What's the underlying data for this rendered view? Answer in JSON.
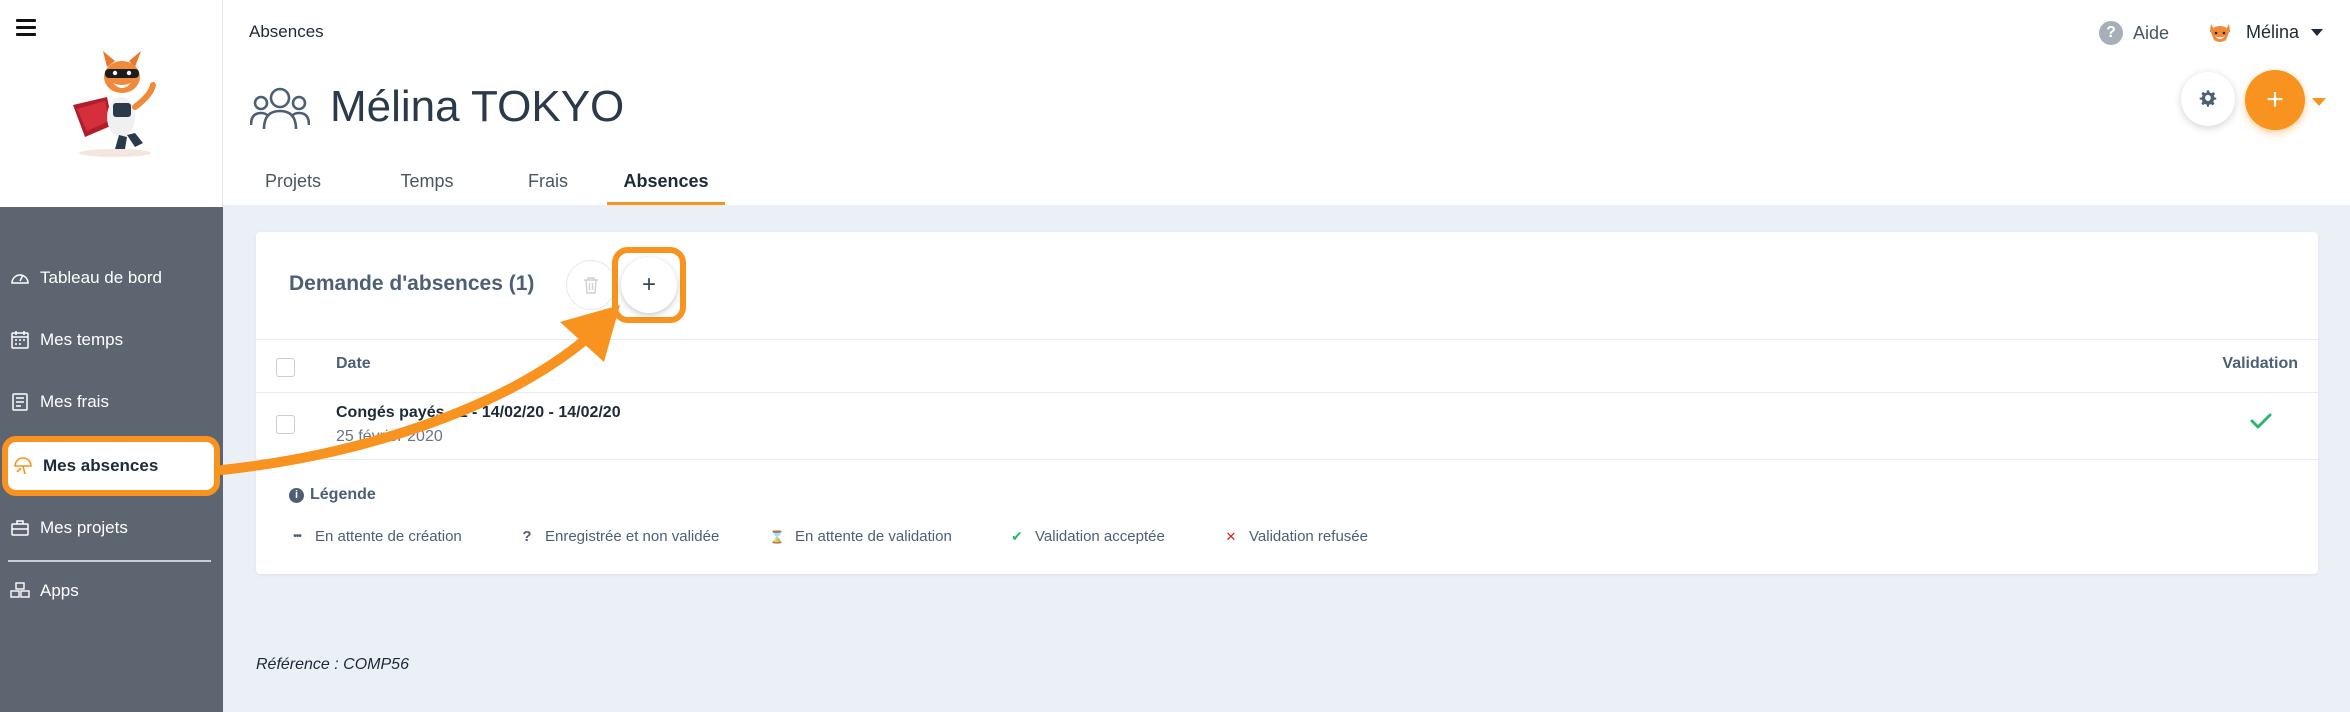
{
  "sidebar": {
    "items": [
      {
        "label": "Tableau de bord",
        "icon": "dashboard-icon"
      },
      {
        "label": "Mes temps",
        "icon": "calendar-icon"
      },
      {
        "label": "Mes frais",
        "icon": "receipt-icon"
      },
      {
        "label": "Mes absences",
        "icon": "umbrella-icon",
        "active": true
      },
      {
        "label": "Mes projets",
        "icon": "briefcase-icon"
      },
      {
        "label": "Apps",
        "icon": "apps-icon"
      }
    ]
  },
  "header": {
    "breadcrumb": "Absences",
    "help_label": "Aide",
    "user_name": "Mélina",
    "title": "Mélina TOKYO"
  },
  "tabs": [
    {
      "label": "Projets"
    },
    {
      "label": "Temps"
    },
    {
      "label": "Frais"
    },
    {
      "label": "Absences",
      "active": true
    }
  ],
  "card": {
    "title": "Demande d'absences (1)",
    "columns": {
      "date": "Date",
      "validation": "Validation"
    },
    "rows": [
      {
        "title": "Congés payés - 1 - 14/02/20 - 14/02/20",
        "date": "25 février 2020",
        "status": "accepted"
      }
    ],
    "legend": {
      "title": "Légende",
      "items": [
        {
          "symbol": "•••",
          "label": "En attente de création",
          "color": "#4e5f75"
        },
        {
          "symbol": "?",
          "label": "Enregistrée et non validée",
          "color": "#4e5f75"
        },
        {
          "symbol": "⌛",
          "label": "En attente de validation",
          "color": "#4e5f75"
        },
        {
          "symbol": "✔",
          "label": "Validation acceptée",
          "color": "#2bb673"
        },
        {
          "symbol": "✕",
          "label": "Validation refusée",
          "color": "#e02020"
        }
      ]
    }
  },
  "footer": {
    "reference_label": "Référence :",
    "reference_value": "COMP56"
  },
  "colors": {
    "accent": "#f7931e",
    "sidebar": "#5d6670",
    "success": "#2bb673",
    "danger": "#e02020"
  }
}
